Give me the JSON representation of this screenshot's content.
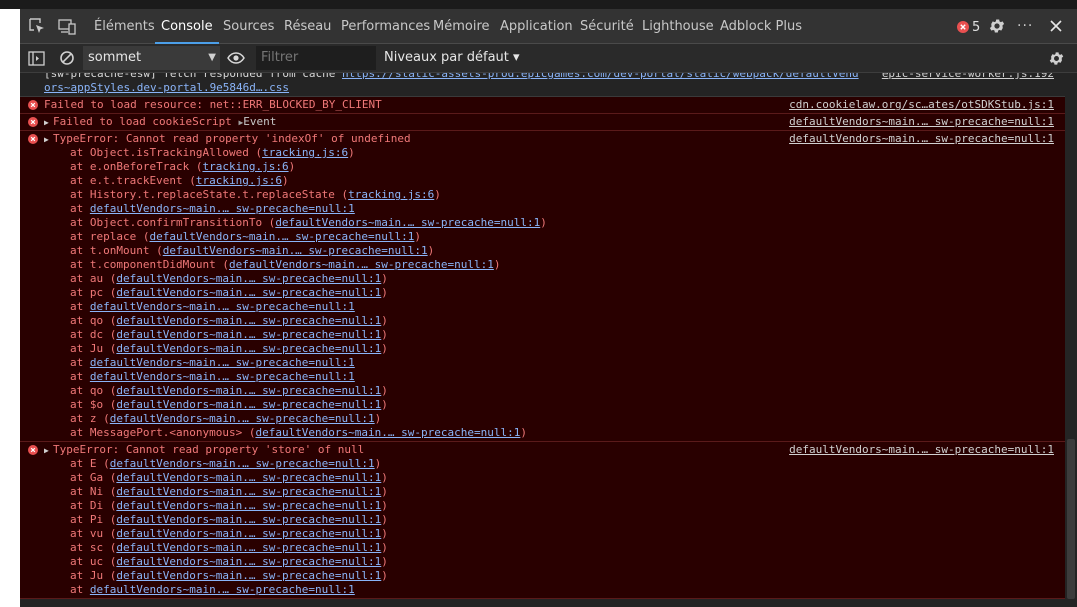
{
  "tabs": [
    "Éléments",
    "Console",
    "Sources",
    "Réseau",
    "Performances",
    "Mémoire",
    "Application",
    "Sécurité",
    "Lighthouse",
    "Adblock Plus"
  ],
  "active_tab": "Console",
  "error_count": "5",
  "toolbar": {
    "context": "sommet",
    "filter_placeholder": "Filtrer",
    "levels": "Niveaux par défaut ▾"
  },
  "colors": {
    "accent": "#4c9fe8",
    "error_bg": "#290000",
    "error_text": "#f07878",
    "link": "#8ab4f8"
  },
  "messages": [
    {
      "kind": "info",
      "prefix": "[sw-precache-esw] fetch responded from cache ",
      "url": "https://static-assets-prod.epicgames.com/dev-portal/static/webpack/defaultVend",
      "url2": "ors~appStyles.dev-portal.9e5846d….css",
      "source": "epic-service-worker.js:192"
    },
    {
      "kind": "err",
      "text": "Failed to load resource: net::ERR_BLOCKED_BY_CLIENT",
      "source": "cdn.cookielaw.org/sc…ates/otSDKStub.js:1"
    },
    {
      "kind": "err",
      "text": "Failed to load cookieScript",
      "event": "Event",
      "source": "defaultVendors~main.… sw-precache=null:1"
    },
    {
      "kind": "err",
      "text": "TypeError: Cannot read property 'indexOf' of undefined",
      "source": "defaultVendors~main.… sw-precache=null:1",
      "stack": [
        {
          "fn": "Object.isTrackingAllowed",
          "loc": "tracking.js:6"
        },
        {
          "fn": "e.onBeforeTrack",
          "loc": "tracking.js:6"
        },
        {
          "fn": "e.t.trackEvent",
          "loc": "tracking.js:6"
        },
        {
          "fn": "History.t.replaceState.t.replaceState",
          "loc": "tracking.js:6"
        },
        {
          "fn": "",
          "loc": "defaultVendors~main.… sw-precache=null:1"
        },
        {
          "fn": "Object.confirmTransitionTo",
          "loc": "defaultVendors~main.… sw-precache=null:1"
        },
        {
          "fn": "replace",
          "loc": "defaultVendors~main.… sw-precache=null:1"
        },
        {
          "fn": "t.onMount",
          "loc": "defaultVendors~main.… sw-precache=null:1"
        },
        {
          "fn": "t.componentDidMount",
          "loc": "defaultVendors~main.… sw-precache=null:1"
        },
        {
          "fn": "au",
          "loc": "defaultVendors~main.… sw-precache=null:1"
        },
        {
          "fn": "pc",
          "loc": "defaultVendors~main.… sw-precache=null:1"
        },
        {
          "fn": "",
          "loc": "defaultVendors~main.… sw-precache=null:1"
        },
        {
          "fn": "qo",
          "loc": "defaultVendors~main.… sw-precache=null:1"
        },
        {
          "fn": "dc",
          "loc": "defaultVendors~main.… sw-precache=null:1"
        },
        {
          "fn": "Ju",
          "loc": "defaultVendors~main.… sw-precache=null:1"
        },
        {
          "fn": "",
          "loc": "defaultVendors~main.… sw-precache=null:1"
        },
        {
          "fn": "",
          "loc": "defaultVendors~main.… sw-precache=null:1"
        },
        {
          "fn": "qo",
          "loc": "defaultVendors~main.… sw-precache=null:1"
        },
        {
          "fn": "$o",
          "loc": "defaultVendors~main.… sw-precache=null:1"
        },
        {
          "fn": "z",
          "loc": "defaultVendors~main.… sw-precache=null:1"
        },
        {
          "fn": "MessagePort.<anonymous>",
          "loc": "defaultVendors~main.… sw-precache=null:1"
        }
      ]
    },
    {
      "kind": "err",
      "text": "TypeError: Cannot read property 'store' of null",
      "source": "defaultVendors~main.… sw-precache=null:1",
      "stack": [
        {
          "fn": "E",
          "loc": "defaultVendors~main.… sw-precache=null:1"
        },
        {
          "fn": "Ga",
          "loc": "defaultVendors~main.… sw-precache=null:1"
        },
        {
          "fn": "Ni",
          "loc": "defaultVendors~main.… sw-precache=null:1"
        },
        {
          "fn": "Di",
          "loc": "defaultVendors~main.… sw-precache=null:1"
        },
        {
          "fn": "Pi",
          "loc": "defaultVendors~main.… sw-precache=null:1"
        },
        {
          "fn": "vu",
          "loc": "defaultVendors~main.… sw-precache=null:1"
        },
        {
          "fn": "sc",
          "loc": "defaultVendors~main.… sw-precache=null:1"
        },
        {
          "fn": "uc",
          "loc": "defaultVendors~main.… sw-precache=null:1"
        },
        {
          "fn": "Ju",
          "loc": "defaultVendors~main.… sw-precache=null:1"
        },
        {
          "fn": "",
          "loc": "defaultVendors~main.… sw-precache=null:1"
        }
      ]
    }
  ]
}
